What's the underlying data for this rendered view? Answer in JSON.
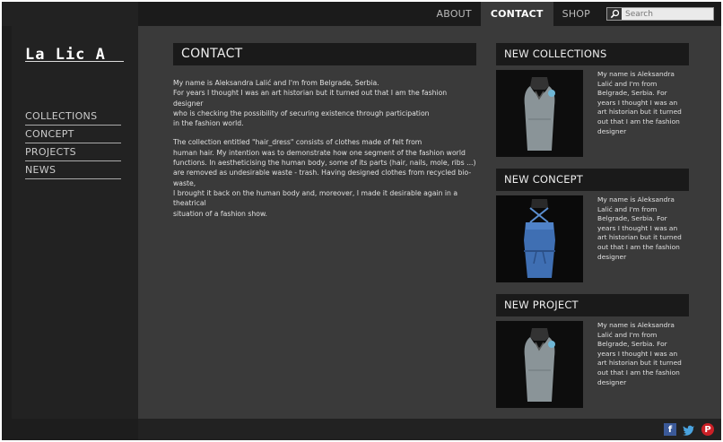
{
  "nav": {
    "items": [
      {
        "label": "ABOUT"
      },
      {
        "label": "CONTACT"
      },
      {
        "label": "SHOP"
      }
    ],
    "search_placeholder": "Search"
  },
  "logo": {
    "text": "La Lic A"
  },
  "sidebar": {
    "items": [
      {
        "label": "COLLECTIONS"
      },
      {
        "label": "CONCEPT"
      },
      {
        "label": "PROJECTS"
      },
      {
        "label": "NEWS"
      }
    ]
  },
  "main": {
    "title": "CONTACT",
    "paragraph1": "My name is Aleksandra Lalić and I'm from Belgrade, Serbia.\nFor years I thought I was an art historian but it turned out that I am the fashion designer\nwho is checking the possibility of securing existence through participation\nin the fashion world.",
    "paragraph2": "The collection entitled \"hair_dress\" consists of clothes made of felt from\nhuman hair. My intention was to demonstrate how one segment of the fashion world\nfunctions. In aestheticising the human body, some of its parts (hair, nails, mole, ribs ...)\nare removed as undesirable waste - trash. Having designed clothes from recycled bio-waste,\nI brought it back on the human body and, moreover, I made it desirable again in a theatrical\nsituation of a fashion show."
  },
  "cards": [
    {
      "title": "NEW COLLECTIONS",
      "text": "My name is Aleksandra Lalić and I'm from Belgrade, Serbia. For years I thought I was an art historian but it turned out that I am the fashion designer"
    },
    {
      "title": "NEW CONCEPT",
      "text": "My name is Aleksandra Lalić and I'm from Belgrade, Serbia. For years I thought I was an art historian but it turned out that I am the fashion designer"
    },
    {
      "title": "NEW PROJECT",
      "text": "My name is Aleksandra Lalić and I'm from Belgrade, Serbia. For years I thought I was an art historian but it turned out that I am the fashion designer"
    }
  ],
  "footer": {
    "social": [
      "facebook-icon",
      "twitter-icon",
      "pinterest-icon"
    ]
  },
  "colors": {
    "background": "#3a3a3a",
    "sidebar": "#222222",
    "heading_bar": "#1a1a1a",
    "active_tab": "#3a3a3a"
  }
}
